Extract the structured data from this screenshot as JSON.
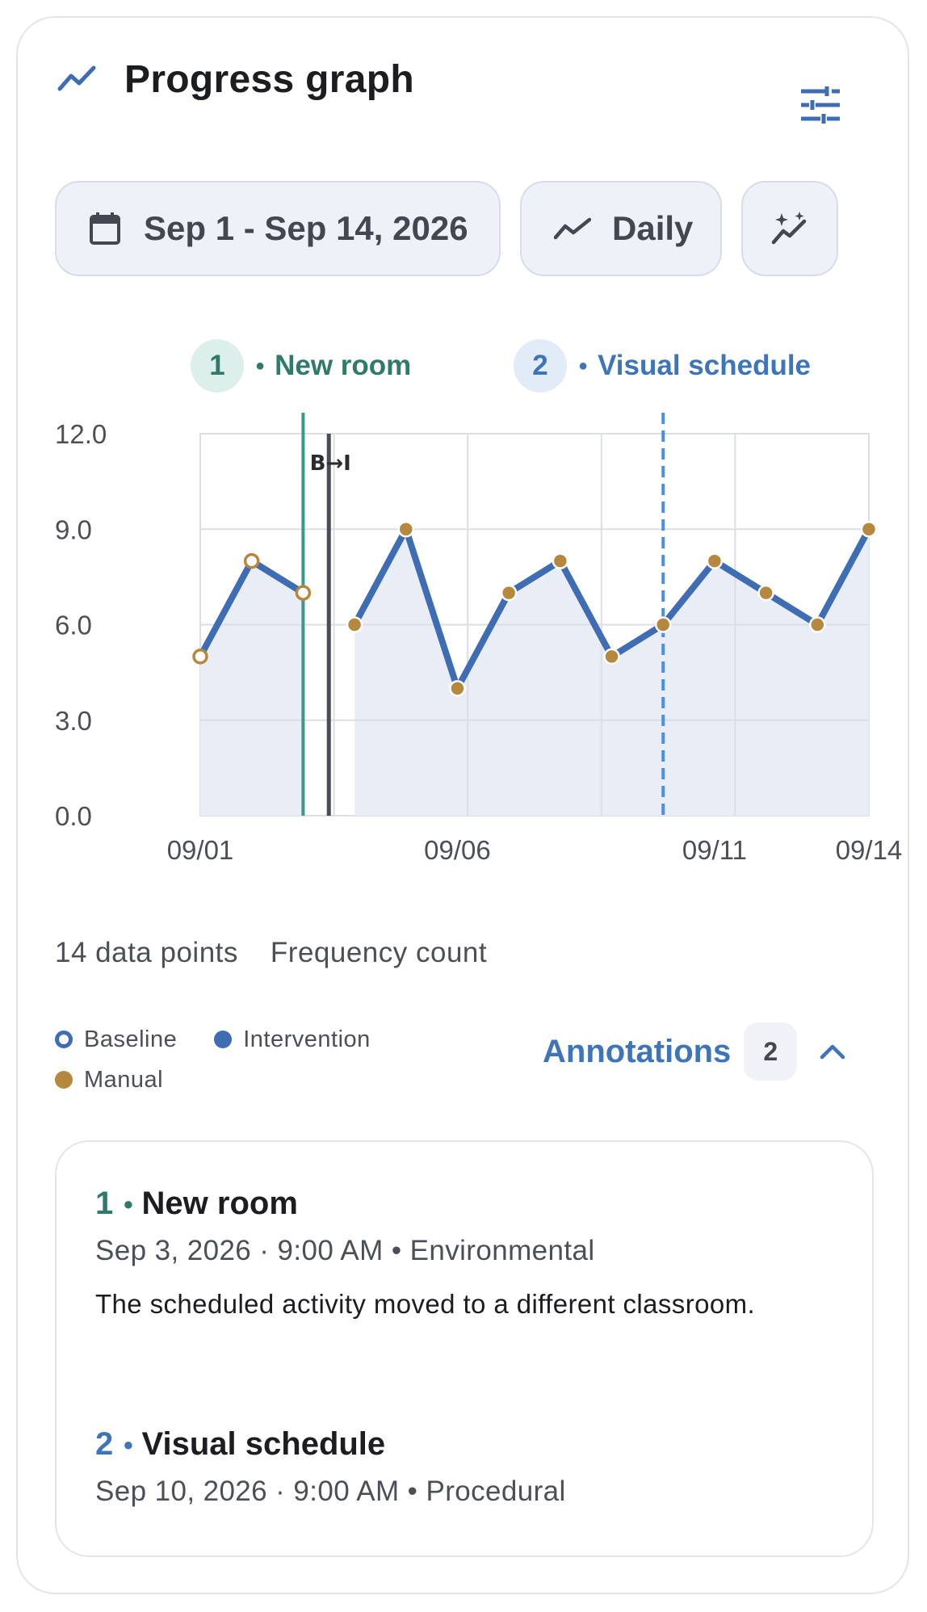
{
  "header": {
    "title": "Progress graph",
    "icon": "trend-line-icon",
    "settings_icon": "tune-sliders-icon"
  },
  "filters": {
    "date_range": "Sep 1 - Sep 14, 2026",
    "interval": "Daily",
    "date_icon": "calendar-icon",
    "interval_icon": "trend-line-icon",
    "ai_icon": "sparkle-trend-icon"
  },
  "markers": [
    {
      "number": "1",
      "label": "New room",
      "color": "#2f7a6a"
    },
    {
      "number": "2",
      "label": "Visual schedule",
      "color": "#3e74b8"
    }
  ],
  "chart_data": {
    "type": "line",
    "x": [
      "09/01",
      "09/02",
      "09/03",
      "09/04",
      "09/05",
      "09/06",
      "09/07",
      "09/08",
      "09/09",
      "09/10",
      "09/11",
      "09/12",
      "09/13",
      "09/14"
    ],
    "x_tick_labels": [
      "09/01",
      "09/06",
      "09/11",
      "09/14"
    ],
    "ylim": [
      0,
      12
    ],
    "y_ticks": [
      "0.0",
      "3.0",
      "6.0",
      "9.0",
      "12.0"
    ],
    "grid": true,
    "series": [
      {
        "name": "Baseline",
        "x": [
          "09/01",
          "09/02",
          "09/03"
        ],
        "values": [
          5,
          8,
          7
        ]
      },
      {
        "name": "Intervention",
        "x": [
          "09/04",
          "09/05",
          "09/06",
          "09/07",
          "09/08",
          "09/09",
          "09/10",
          "09/11",
          "09/12",
          "09/13",
          "09/14"
        ],
        "values": [
          6,
          9,
          4,
          7,
          8,
          5,
          6,
          8,
          7,
          6,
          9
        ]
      }
    ],
    "phase_change": {
      "label": "B→I"
    },
    "annotation_lines": [
      {
        "number": "1",
        "date": "09/03"
      },
      {
        "number": "2",
        "date": "09/10"
      }
    ],
    "colors": {
      "line": "#3e6db4",
      "manual_point": "#b5883e",
      "marker1": "#3a9a83",
      "marker2": "#4a90e2",
      "phase": "#4a4d55"
    }
  },
  "meta": {
    "points": "14 data points",
    "measure": "Frequency count"
  },
  "legend": {
    "baseline": "Baseline",
    "intervention": "Intervention",
    "manual": "Manual"
  },
  "annotations_toggle": {
    "label": "Annotations",
    "count": "2"
  },
  "annotations": [
    {
      "number": "1",
      "title": "New room",
      "subtitle": "Sep 3, 2026 · 9:00 AM • Environmental",
      "body": "The scheduled activity moved to a different classroom."
    },
    {
      "number": "2",
      "title": "Visual schedule",
      "subtitle": "Sep 10, 2026 · 9:00 AM • Procedural"
    }
  ]
}
